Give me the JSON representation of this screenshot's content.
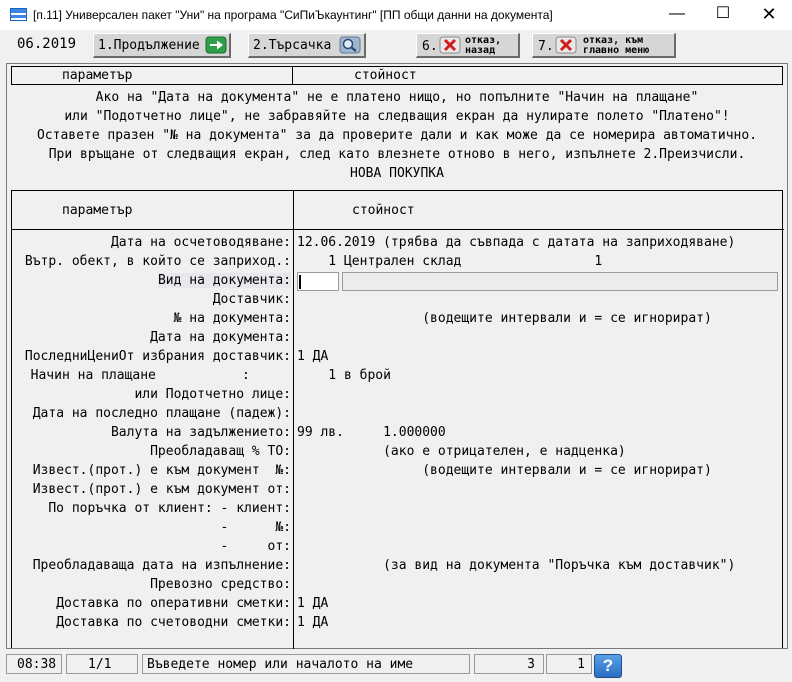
{
  "window": {
    "title": "[п.11] Универсален пакет \"Уни\" на програма \"СиПиЪкаунтинг\" [ПП общи данни на документа]",
    "icons": [
      "app-icon",
      "minimize-icon",
      "maximize-icon",
      "close-icon"
    ]
  },
  "toolbar": {
    "period": "06.2019",
    "buttons": [
      {
        "label": "1.Продължение",
        "icon": "arrow-right-icon"
      },
      {
        "label": "2.Търсачка",
        "icon": "magnifier-icon"
      },
      {
        "number": "6.",
        "label_line1": "отказ,",
        "label_line2": "назад",
        "icon": "cancel-x-icon"
      },
      {
        "number": "7.",
        "label_line1": "отказ, към",
        "label_line2": "главно меню",
        "icon": "cancel-x-icon"
      }
    ]
  },
  "header": {
    "col1": "параметър",
    "col2": "стойност"
  },
  "message": {
    "line1": "Ако на \"Дата на документа\" не е платено нищо, но попълните \"Начин на плащане\"",
    "line2": "или \"Подотчетно лице\", не забравяйте на следващия екран да нулирате полето \"Платено\"!",
    "line3": "Оставете празен \"№ на документа\" за да проверите дали и как може да се номерира автоматично.",
    "line4": "При връщане от следващия екран, след като влезнете отново в него, изпълнете 2.Преизчисли.",
    "line5": "НОВА ПОКУПКА"
  },
  "grid": {
    "col1": "параметър",
    "col2": "стойност",
    "rows": [
      {
        "label": "Дата на осчетоводяване:",
        "value": "12.06.2019 (трябва да съвпада с датата на заприходяване)"
      },
      {
        "label": "Вътр. обект, в който се заприход.:",
        "value": "    1 Централен склад                 1"
      },
      {
        "label": "Вид на документа:",
        "value": ""
      },
      {
        "label": "Доставчик:",
        "value": ""
      },
      {
        "label": "№ на документа:",
        "value": "                (водещите интервали и = се игнорират)"
      },
      {
        "label": "Дата на документа:",
        "value": ""
      },
      {
        "label": "ПоследниЦениОт избрания доставчик:",
        "value": "1 ДА"
      },
      {
        "label": "  Начин на плащане           :",
        "value": "    1 в брой"
      },
      {
        "label": "или Подотчетно лице:",
        "value": ""
      },
      {
        "label": "Дата на последно плащане (падеж):",
        "value": ""
      },
      {
        "label": "Валута на задължението:",
        "value": "99 лв.     1.000000"
      },
      {
        "label": "Преобладаващ % ТО:",
        "value": "           (ако е отрицателен, е надценка)"
      },
      {
        "label": "Извест.(прот.) е към документ  №:",
        "value": "                (водещите интервали и = се игнорират)"
      },
      {
        "label": "Извест.(прот.) е към документ от:",
        "value": ""
      },
      {
        "label": "По поръчка от клиент: - клиент:",
        "value": ""
      },
      {
        "label": "-      №:",
        "value": ""
      },
      {
        "label": "-     от:",
        "value": ""
      },
      {
        "label": "Преобладаваща дата на изпълнение:",
        "value": "           (за вид на документа \"Поръчка към доставчик\")"
      },
      {
        "label": "Превозно средство:",
        "value": ""
      },
      {
        "label": "Доставка по оперативни сметки:",
        "value": "1 ДА"
      },
      {
        "label": "Доставка по счетоводни сметки:",
        "value": "1 ДА"
      }
    ]
  },
  "status": {
    "time": "08:38",
    "page": "1/1",
    "hint": "Въведете номер или началото на име",
    "count": "3",
    "current": "1",
    "help": "?"
  }
}
